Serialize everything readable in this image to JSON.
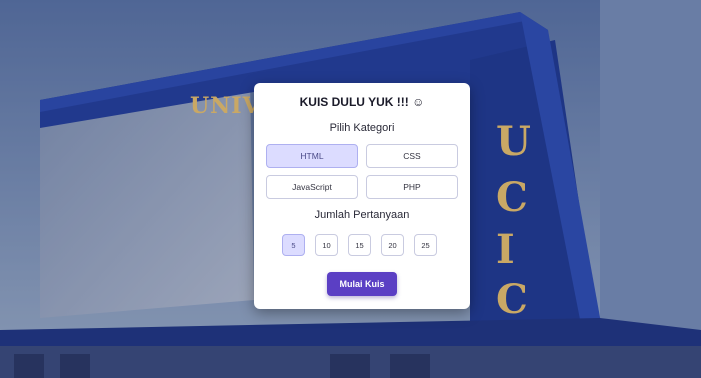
{
  "background": {
    "sign_text": "UNIVI",
    "vertical_letters": [
      "U",
      "C",
      "I",
      "C"
    ],
    "colors": {
      "sky": "#8aa5cc",
      "building_blue": "#1f3fa8",
      "gold": "#c9a865"
    }
  },
  "quiz": {
    "title": "KUIS DULU YUK !!! ☺",
    "category_label": "Pilih Kategori",
    "categories": [
      {
        "label": "HTML",
        "selected": true
      },
      {
        "label": "CSS",
        "selected": false
      },
      {
        "label": "JavaScript",
        "selected": false
      },
      {
        "label": "PHP",
        "selected": false
      }
    ],
    "question_count_label": "Jumlah Pertanyaan",
    "question_counts": [
      {
        "label": "5",
        "selected": true
      },
      {
        "label": "10",
        "selected": false
      },
      {
        "label": "15",
        "selected": false
      },
      {
        "label": "20",
        "selected": false
      },
      {
        "label": "25",
        "selected": false
      }
    ],
    "start_button": "Mulai Kuis",
    "colors": {
      "accent": "#5b3fc4",
      "selected_bg": "#dcdcff",
      "border": "#c9cbe0"
    }
  }
}
